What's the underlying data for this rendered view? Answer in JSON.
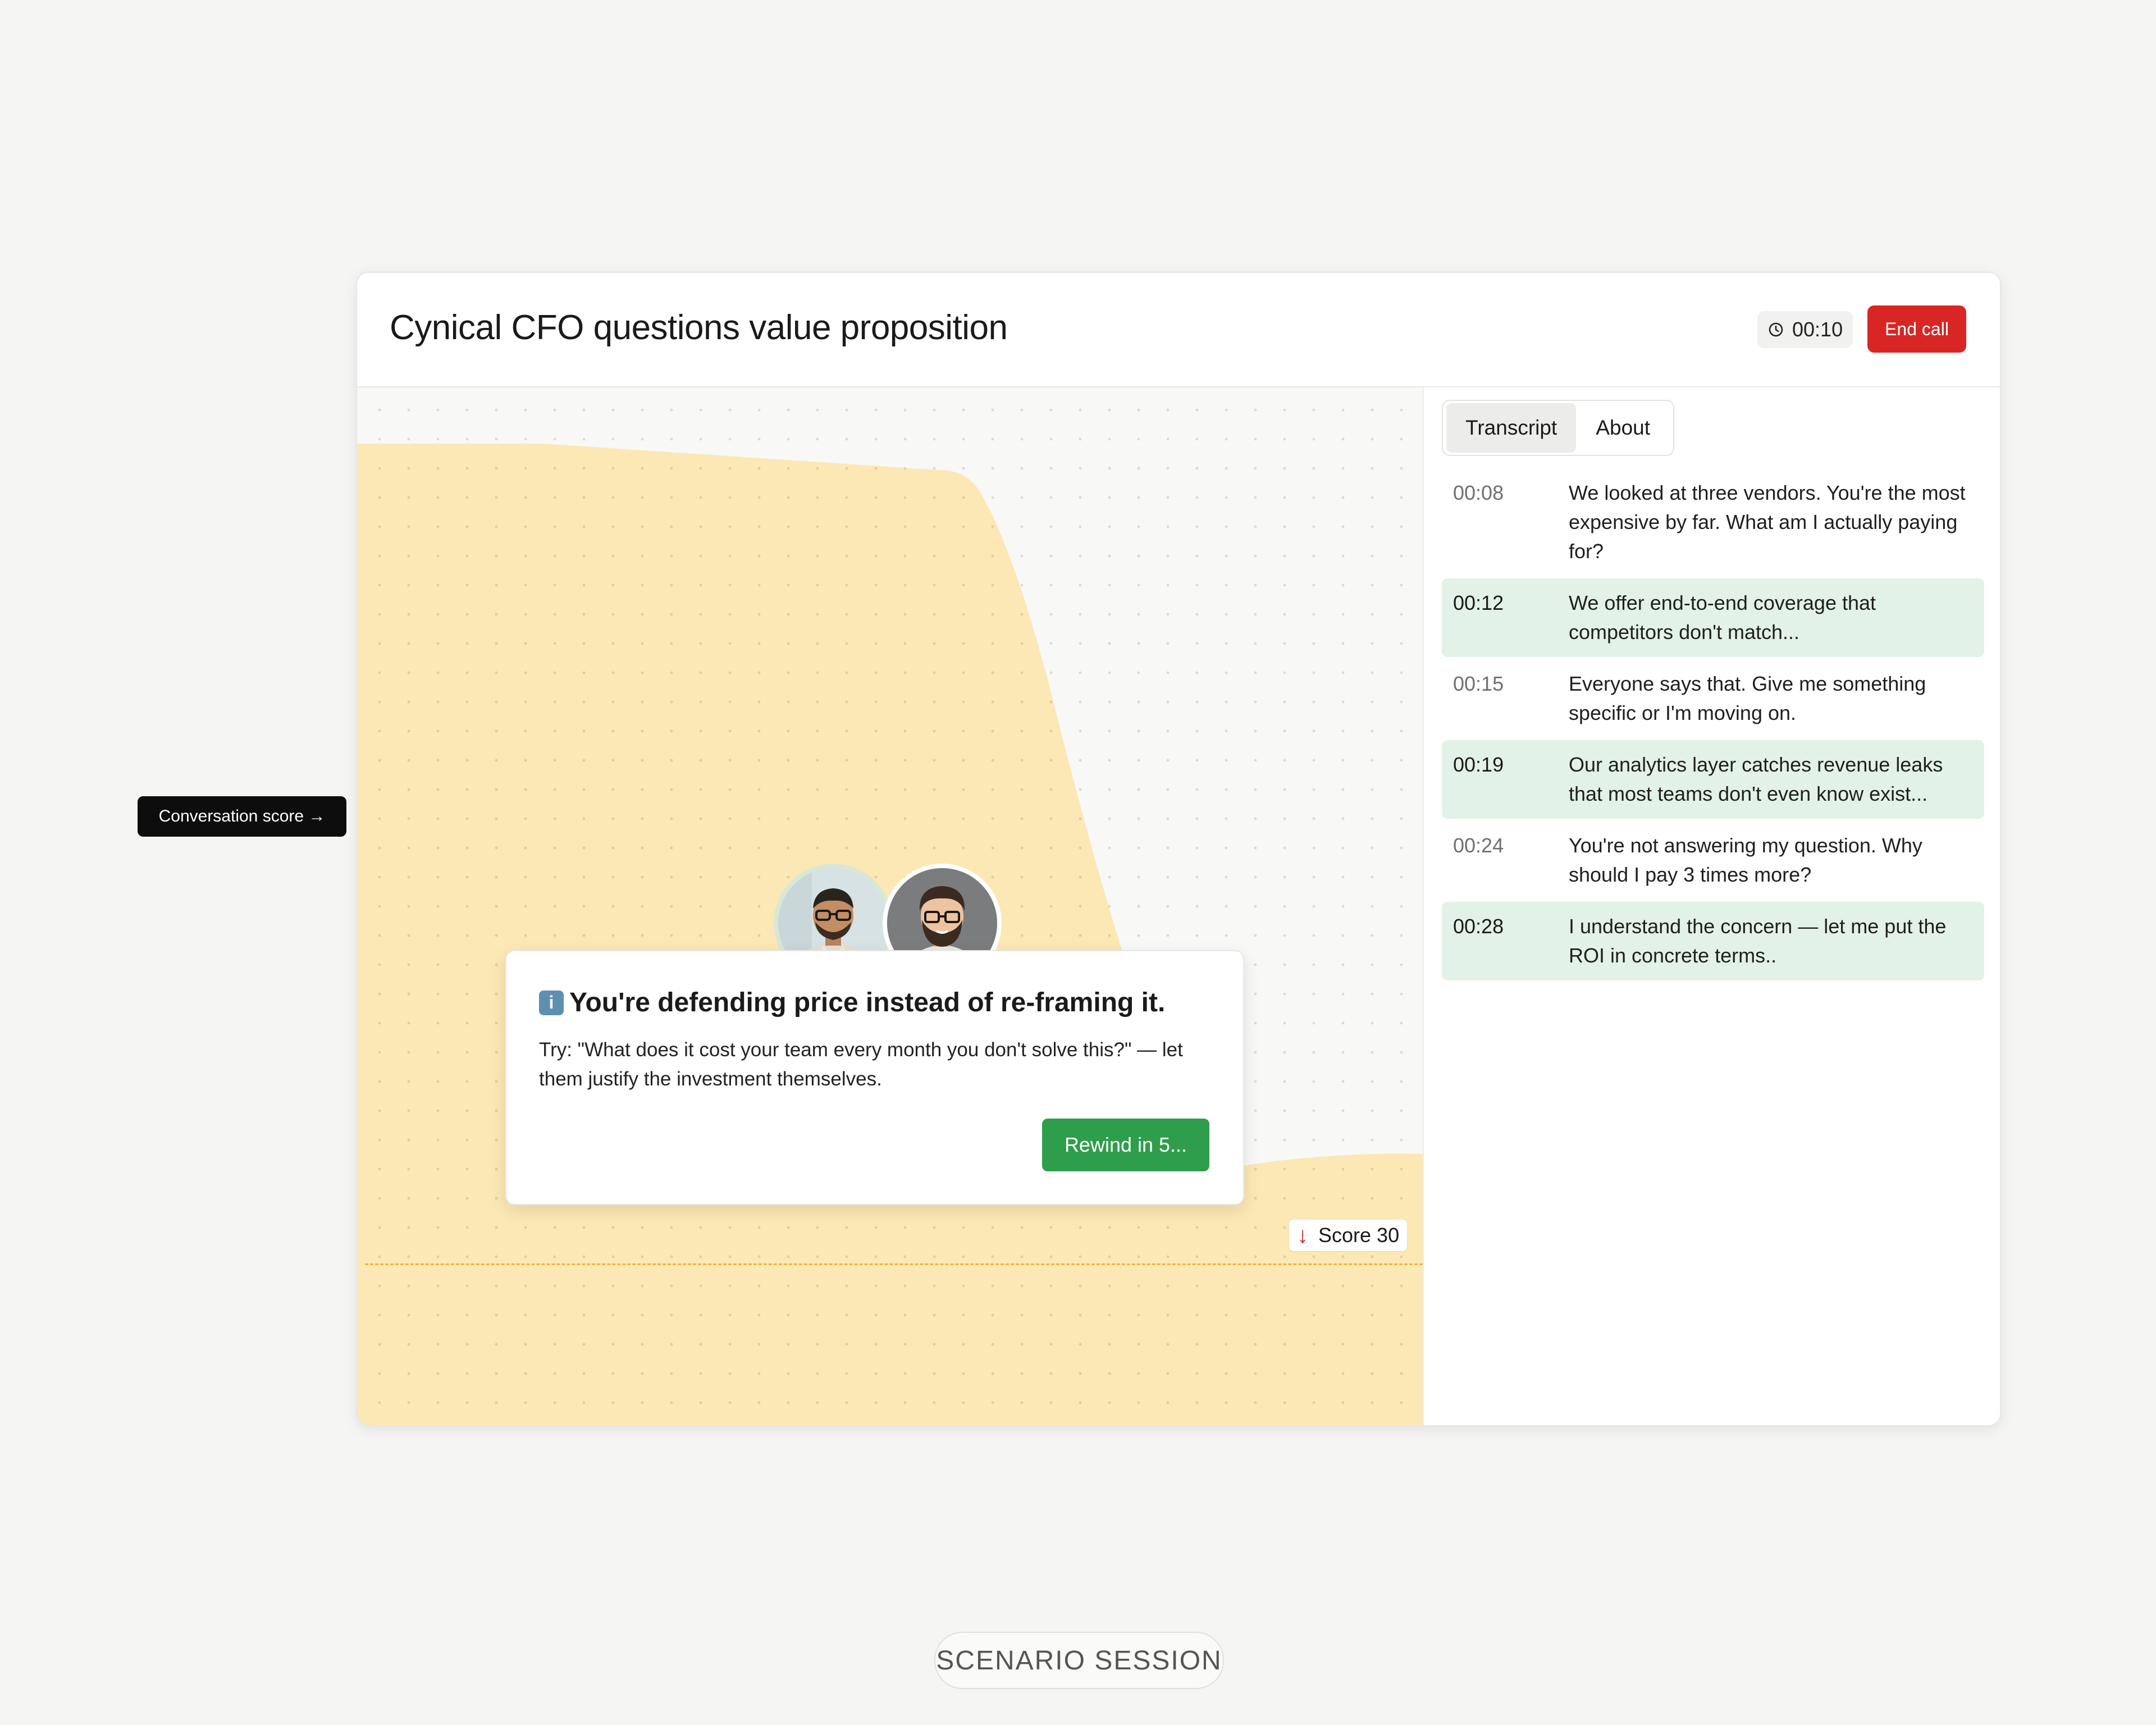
{
  "header": {
    "title": "Cynical CFO questions value proposition",
    "timer": "00:10",
    "end_call_label": "End call"
  },
  "stage": {
    "score_label": "Score 30",
    "score_value": 30,
    "score_trend": "down",
    "fill_color": "#fbe8b4",
    "dash_color": "#e6b93d"
  },
  "coach": {
    "title": "You're defending price instead of re-framing it.",
    "body": "Try: \"What does it cost your team every month you don't solve this?\" — let them justify the investment themselves.",
    "rewind_label": "Rewind in 5..."
  },
  "tabs": [
    {
      "label": "Transcript",
      "active": true
    },
    {
      "label": "About",
      "active": false
    }
  ],
  "transcript": [
    {
      "time": "00:08",
      "text": "We looked at three vendors. You're the most expensive by far. What am I actually paying for?",
      "speaker": "cfo"
    },
    {
      "time": "00:12",
      "text": "We offer end-to-end coverage that competitors don't match...",
      "speaker": "user"
    },
    {
      "time": "00:15",
      "text": "Everyone says that. Give me something specific or I'm moving on.",
      "speaker": "cfo"
    },
    {
      "time": "00:19",
      "text": "Our analytics layer catches revenue leaks that most teams don't even know exist...",
      "speaker": "user"
    },
    {
      "time": "00:24",
      "text": "You're not answering my question. Why should I pay 3 times more?",
      "speaker": "cfo"
    },
    {
      "time": "00:28",
      "text": "I understand the concern — let me put the ROI in concrete terms..",
      "speaker": "user"
    }
  ],
  "side_label": "Conversation score →",
  "footer_label": "SCENARIO SESSION",
  "colors": {
    "accent_red": "#d92625",
    "accent_green": "#2f9e4c",
    "user_row_bg": "#e2f2e6"
  }
}
